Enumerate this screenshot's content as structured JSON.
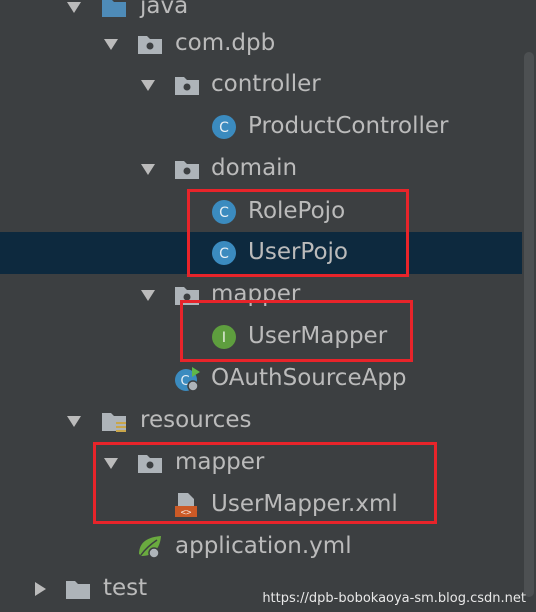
{
  "tree": {
    "items": [
      {
        "label": "java",
        "type": "source-folder"
      },
      {
        "label": "com.dpb",
        "type": "package"
      },
      {
        "label": "controller",
        "type": "package"
      },
      {
        "label": "ProductController",
        "type": "class"
      },
      {
        "label": "domain",
        "type": "package"
      },
      {
        "label": "RolePojo",
        "type": "class"
      },
      {
        "label": "UserPojo",
        "type": "class"
      },
      {
        "label": "mapper",
        "type": "package"
      },
      {
        "label": "UserMapper",
        "type": "interface"
      },
      {
        "label": "OAuthSourceApp",
        "type": "spring-boot-app"
      },
      {
        "label": "resources",
        "type": "resources-folder"
      },
      {
        "label": "mapper",
        "type": "folder"
      },
      {
        "label": "UserMapper.xml",
        "type": "xml-file"
      },
      {
        "label": "application.yml",
        "type": "yml-file"
      },
      {
        "label": "test",
        "type": "folder"
      }
    ],
    "selected_item": "UserPojo"
  },
  "watermark": "https://dpb-bobokaoya-sm.blog.csdn.net",
  "colors": {
    "background": "#3c3f41",
    "selection": "#0d293e",
    "highlight_box": "#e8242a",
    "text": "#bbbbbb"
  }
}
